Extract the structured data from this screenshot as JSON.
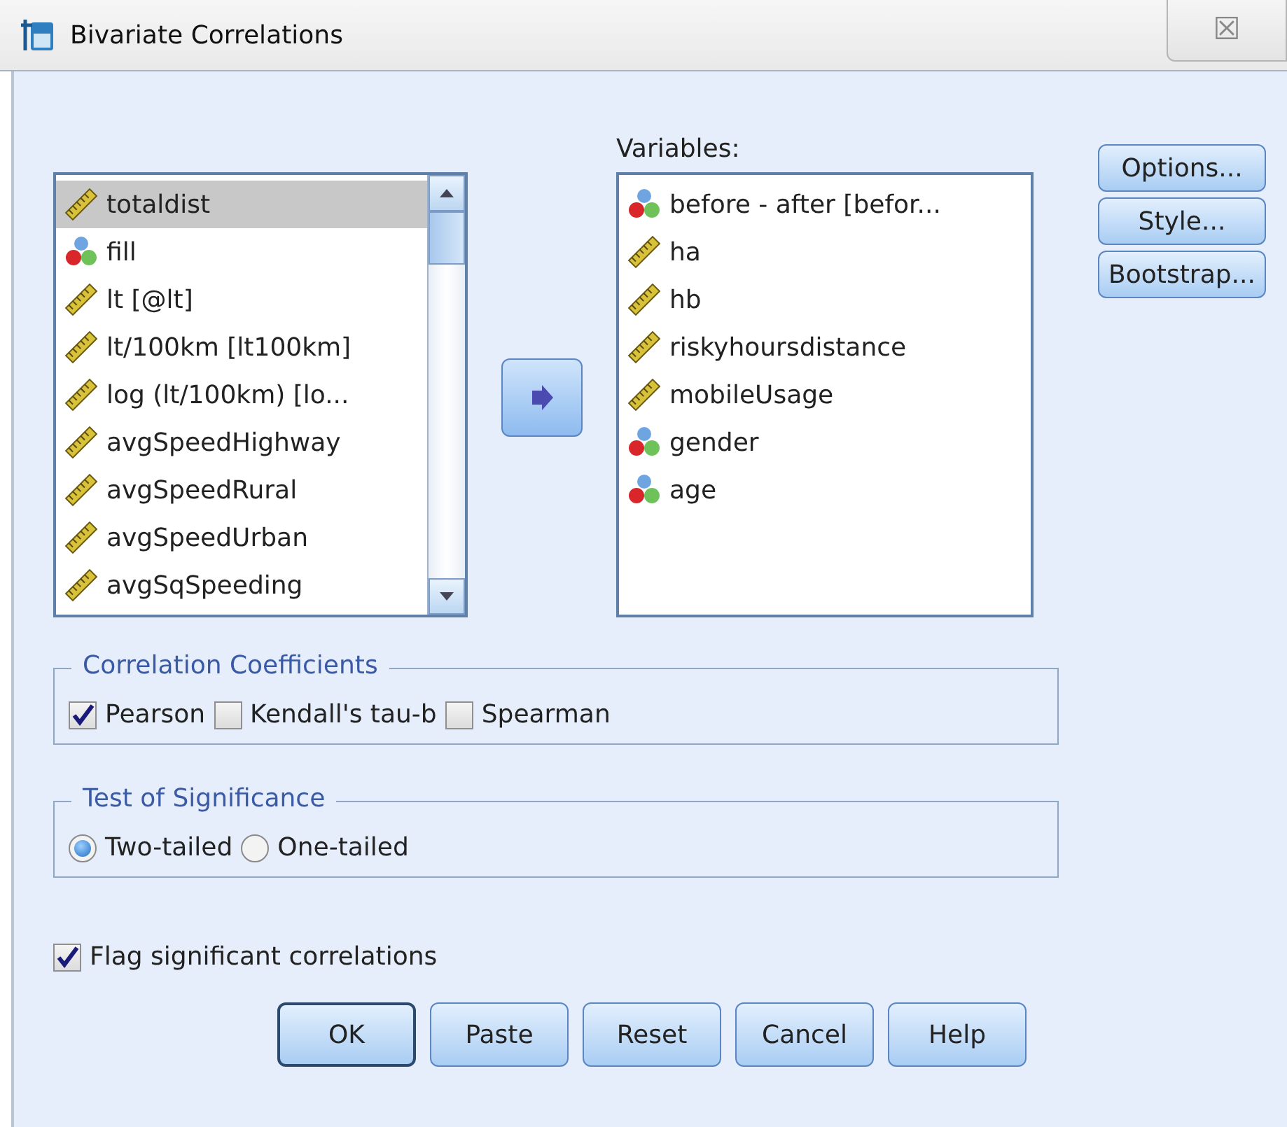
{
  "window": {
    "title": "Bivariate Correlations",
    "close": "☒"
  },
  "source_list": {
    "items": [
      {
        "label": "totaldist",
        "kind": "scale",
        "selected": true
      },
      {
        "label": "fill",
        "kind": "nominal",
        "selected": false
      },
      {
        "label": "lt [@lt]",
        "kind": "scale",
        "selected": false
      },
      {
        "label": "lt/100km [lt100km]",
        "kind": "scale",
        "selected": false
      },
      {
        "label": "log (lt/100km) [lo...",
        "kind": "scale",
        "selected": false
      },
      {
        "label": "avgSpeedHighway",
        "kind": "scale",
        "selected": false
      },
      {
        "label": "avgSpeedRural",
        "kind": "scale",
        "selected": false
      },
      {
        "label": "avgSpeedUrban",
        "kind": "scale",
        "selected": false
      },
      {
        "label": "avgSqSpeeding",
        "kind": "scale",
        "selected": false
      }
    ]
  },
  "variables": {
    "label": "Variables:",
    "items": [
      {
        "label": "before - after  [befor...",
        "kind": "nominal"
      },
      {
        "label": "ha",
        "kind": "scale"
      },
      {
        "label": "hb",
        "kind": "scale"
      },
      {
        "label": "riskyhoursdistance",
        "kind": "scale"
      },
      {
        "label": "mobileUsage",
        "kind": "scale"
      },
      {
        "label": "gender",
        "kind": "nominal"
      },
      {
        "label": "age",
        "kind": "nominal"
      }
    ]
  },
  "side_buttons": [
    "Options...",
    "Style...",
    "Bootstrap..."
  ],
  "correlation_coefficients": {
    "title": "Correlation Coefficients",
    "options": [
      {
        "label": "Pearson",
        "checked": true
      },
      {
        "label": "Kendall's tau-b",
        "checked": false
      },
      {
        "label": "Spearman",
        "checked": false
      }
    ]
  },
  "test_of_significance": {
    "title": "Test of Significance",
    "options": [
      {
        "label": "Two-tailed",
        "selected": true
      },
      {
        "label": "One-tailed",
        "selected": false
      }
    ]
  },
  "flag": {
    "label": "Flag significant correlations",
    "checked": true
  },
  "buttons": [
    {
      "label": "OK",
      "default": true
    },
    {
      "label": "Paste",
      "default": false
    },
    {
      "label": "Reset",
      "default": false
    },
    {
      "label": "Cancel",
      "default": false
    },
    {
      "label": "Help",
      "default": false
    }
  ]
}
